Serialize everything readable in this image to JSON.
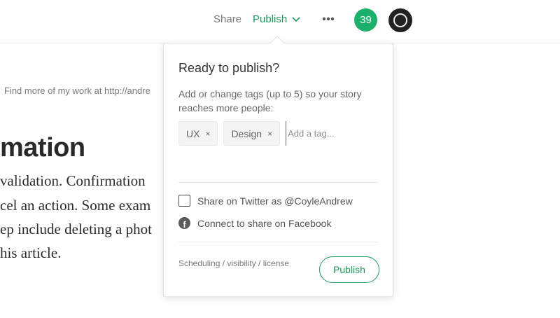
{
  "header": {
    "share_label": "Share",
    "publish_label": "Publish",
    "notification_count": "39"
  },
  "article": {
    "bio": "Find more of my work at http://andre",
    "title": "mation",
    "lines": [
      "validation. Confirmation",
      "cel an action. Some exam",
      "ep include deleting a phot",
      "his article."
    ]
  },
  "popover": {
    "title": "Ready to publish?",
    "description": "Add or change tags (up to 5) so your story reaches more people:",
    "tags": [
      {
        "label": "UX",
        "remove": "×"
      },
      {
        "label": "Design",
        "remove": "×"
      }
    ],
    "tag_input_placeholder": "Add a tag...",
    "twitter_option": "Share on Twitter as @CoyleAndrew",
    "facebook_option": "Connect to share on Facebook",
    "footer_link": "Scheduling / visibility / license",
    "publish_button": "Publish"
  },
  "colors": {
    "accent": "#1a9a5a",
    "badge": "#1ab26b"
  },
  "icons": [
    "chevron-down-icon",
    "more-icon",
    "facebook-icon"
  ]
}
